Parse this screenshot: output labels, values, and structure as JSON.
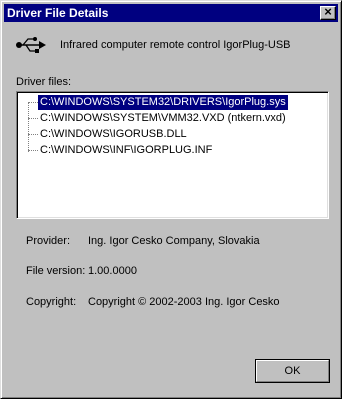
{
  "window": {
    "title": "Driver File Details",
    "close_symbol": "×"
  },
  "device": {
    "icon": "usb-icon",
    "name": "Infrared computer remote control IgorPlug-USB"
  },
  "driver_files": {
    "label": "Driver files:",
    "items": [
      {
        "path": "C:\\WINDOWS\\SYSTEM32\\DRIVERS\\IgorPlug.sys",
        "selected": true
      },
      {
        "path": "C:\\WINDOWS\\SYSTEM\\VMM32.VXD (ntkern.vxd)",
        "selected": false
      },
      {
        "path": "C:\\WINDOWS\\IGORUSB.DLL",
        "selected": false
      },
      {
        "path": "C:\\WINDOWS\\INF\\IGORPLUG.INF",
        "selected": false
      }
    ]
  },
  "details": {
    "provider_label": "Provider:",
    "provider_value": "Ing. Igor Cesko Company, Slovakia",
    "version_label": "File version:",
    "version_value": "1.00.0000",
    "copyright_label": "Copyright:",
    "copyright_value": "Copyright © 2002-2003 Ing. Igor Cesko"
  },
  "buttons": {
    "ok_label": "OK"
  },
  "colors": {
    "titlebar": "#000080",
    "selection": "#000080",
    "face": "#c0c0c0"
  }
}
